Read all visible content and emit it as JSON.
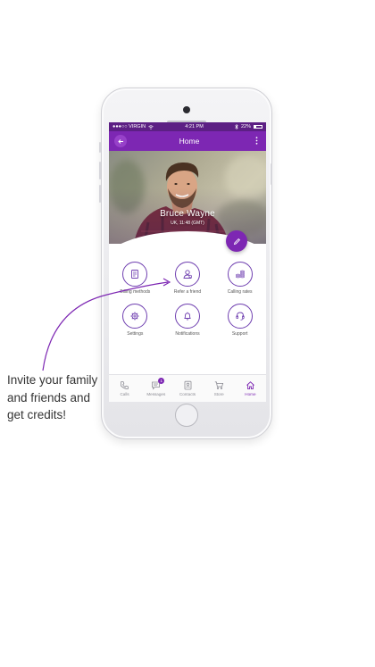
{
  "status_bar": {
    "carrier": "●●●○○ VIRGIN",
    "time": "4:21 PM",
    "battery": "22%"
  },
  "app_bar": {
    "title": "Home"
  },
  "profile": {
    "name": "Bruce Wayne",
    "location": "UK, 11:48 (GMT)"
  },
  "menu": [
    {
      "label": "Billing methods",
      "icon": "billing-icon"
    },
    {
      "label": "Refer a friend",
      "icon": "refer-friend-icon"
    },
    {
      "label": "Calling rates",
      "icon": "calling-rates-icon"
    },
    {
      "label": "Settings",
      "icon": "settings-icon"
    },
    {
      "label": "Notifications",
      "icon": "bell-icon"
    },
    {
      "label": "Support",
      "icon": "headset-icon"
    }
  ],
  "tabs": [
    {
      "label": "Calls",
      "icon": "phone-icon"
    },
    {
      "label": "Messages",
      "icon": "chat-icon",
      "badge": "1"
    },
    {
      "label": "Contacts",
      "icon": "contacts-icon"
    },
    {
      "label": "Store",
      "icon": "cart-icon"
    },
    {
      "label": "Home",
      "icon": "home-icon",
      "active": true
    }
  ],
  "callout": {
    "text": "Invite your family and friends and get credits!"
  },
  "colors": {
    "primary": "#7d27b3",
    "status_bar": "#5c1f84",
    "icon_stroke": "#6f3fb0"
  }
}
